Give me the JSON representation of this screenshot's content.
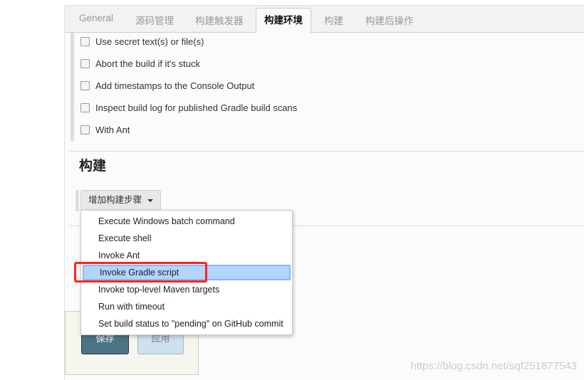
{
  "tabs": [
    {
      "label": "General"
    },
    {
      "label": "源码管理"
    },
    {
      "label": "构建触发器"
    },
    {
      "label": "构建环境",
      "active": true
    },
    {
      "label": "构建"
    },
    {
      "label": "构建后操作"
    }
  ],
  "env_options": [
    "Use secret text(s) or file(s)",
    "Abort the build if it's stuck",
    "Add timestamps to the Console Output",
    "Inspect build log for published Gradle build scans",
    "With Ant"
  ],
  "build": {
    "title": "构建",
    "add_step_label": "增加构建步骤"
  },
  "menu": {
    "items": [
      "Execute Windows batch command",
      "Execute shell",
      "Invoke Ant",
      "Invoke Gradle script",
      "Invoke top-level Maven targets",
      "Run with timeout",
      "Set build status to \"pending\" on GitHub commit"
    ],
    "highlighted": "Invoke Gradle script"
  },
  "buttons": {
    "save": "保存",
    "apply": "应用"
  },
  "watermark": "https://blog.csdn.net/sqf251877543",
  "colors": {
    "highlight": "#b3d4fc",
    "annotation": "#ff2222"
  }
}
